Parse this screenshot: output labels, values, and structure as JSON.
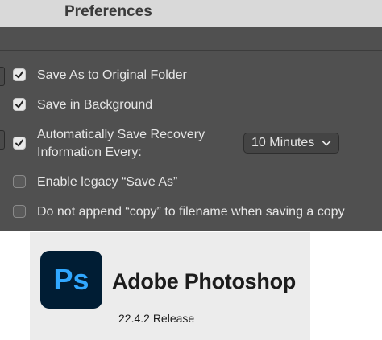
{
  "window": {
    "title": "Preferences"
  },
  "options": [
    {
      "label": "Save As to Original Folder",
      "checked": true
    },
    {
      "label": "Save in Background",
      "checked": true
    },
    {
      "label": "Automatically Save Recovery",
      "label_line2": "Information Every:",
      "checked": true
    },
    {
      "label": "Enable legacy “Save As”",
      "checked": false
    },
    {
      "label": "Do not append “copy” to filename when saving a copy",
      "checked": false
    }
  ],
  "recovery_interval": {
    "selected": "10 Minutes"
  },
  "about": {
    "logo_text": "Ps",
    "product_name": "Adobe Photoshop",
    "version": "22.4.2 Release"
  },
  "colors": {
    "panel_bg": "#505050",
    "titlebar_bg": "#d9d9d9",
    "logo_bg": "#001d34",
    "logo_fg": "#31a8ff"
  }
}
